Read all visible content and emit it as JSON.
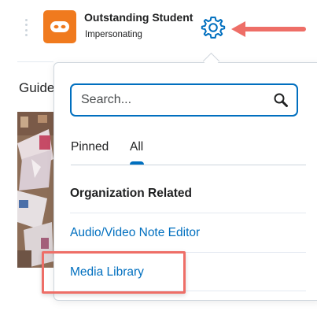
{
  "header": {
    "user_name": "Outstanding Student",
    "user_status": "Impersonating",
    "avatar_icon": "mask-icon",
    "settings_icon": "gear-icon",
    "accent": "#006fbf",
    "avatar_color": "#f07a1e"
  },
  "background": {
    "heading": "Guide"
  },
  "dropdown": {
    "search": {
      "placeholder": "Search...",
      "value": ""
    },
    "tabs": [
      {
        "label": "Pinned",
        "selected": false
      },
      {
        "label": "All",
        "selected": true
      }
    ],
    "groups": [
      {
        "heading": "Organization Related",
        "items": [
          {
            "label": "Audio/Video Note Editor"
          },
          {
            "label": "Media Library"
          }
        ]
      }
    ]
  },
  "annotations": {
    "arrow_color": "#ee6e67",
    "highlight_color": "#ee6e67"
  }
}
